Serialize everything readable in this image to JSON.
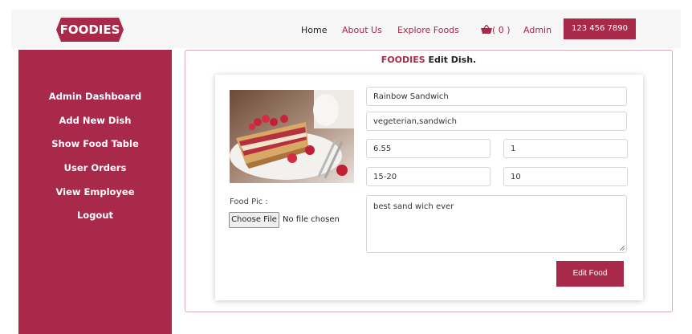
{
  "header": {
    "logo_text": "FOODIES",
    "nav": {
      "home": "Home",
      "about": "About Us",
      "explore": "Explore Foods",
      "cart_count": "( 0 )",
      "admin": "Admin"
    },
    "phone": "123 456 7890"
  },
  "sidebar": {
    "items": [
      {
        "label": "Admin Dashboard"
      },
      {
        "label": "Add New Dish"
      },
      {
        "label": "Show Food Table"
      },
      {
        "label": "User Orders"
      },
      {
        "label": "View Employee"
      },
      {
        "label": "Logout"
      }
    ]
  },
  "main": {
    "title_brand": "FOODIES",
    "title_rest": " Edit Dish.",
    "food_pic_label": "Food Pic :",
    "file_button": "Choose File",
    "file_status": "No file chosen",
    "form": {
      "name": "Rainbow Sandwich",
      "category": "vegeterian,sandwich",
      "price": "6.55",
      "quantity": "1",
      "time": "15-20",
      "discount": "10",
      "description": "best sand wich ever"
    },
    "submit": "Edit Food"
  },
  "colors": {
    "brand": "#a9294b",
    "navbar_bg": "#f6f6f7"
  },
  "icons": {
    "cart": "basket-icon",
    "food_image": "raspberry-french-toast-photo"
  }
}
